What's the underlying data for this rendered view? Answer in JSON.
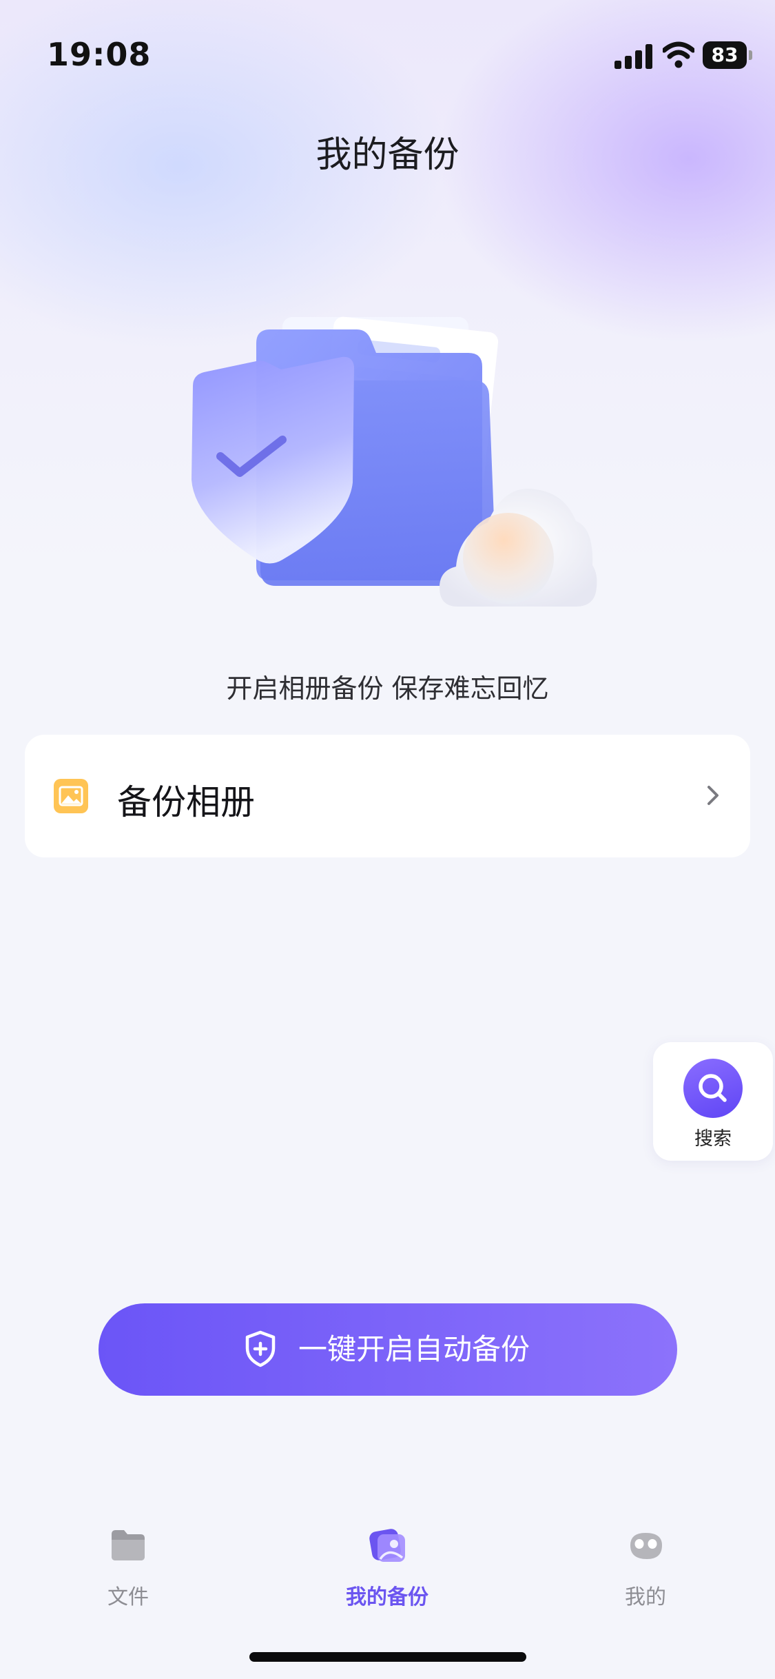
{
  "status_bar": {
    "time": "19:08",
    "battery_level": "83",
    "icons": [
      "cellular-signal-icon",
      "wifi-icon",
      "battery-icon"
    ]
  },
  "header": {
    "title": "我的备份"
  },
  "hero": {
    "illustration": "backup-folder-shield-cloud-illustration",
    "subtitle": "开启相册备份 保存难忘回忆"
  },
  "backup_card": {
    "icon": "photo-album-icon",
    "label": "备份相册",
    "chevron": "chevron-right-icon"
  },
  "floating_search": {
    "icon": "search-icon",
    "label": "搜索"
  },
  "primary_action": {
    "icon": "shield-plus-icon",
    "label": "一键开启自动备份"
  },
  "tab_bar": {
    "tabs": [
      {
        "label": "文件",
        "icon": "folder-icon",
        "active": false
      },
      {
        "label": "我的备份",
        "icon": "backup-photo-icon",
        "active": true
      },
      {
        "label": "我的",
        "icon": "profile-icon",
        "active": false
      }
    ]
  },
  "colors": {
    "accent": "#6b55f0",
    "button_gradient_start": "#6b55f7",
    "button_gradient_end": "#8c72fb",
    "background": "#f4f5fb",
    "album_icon": "#ffc455"
  }
}
